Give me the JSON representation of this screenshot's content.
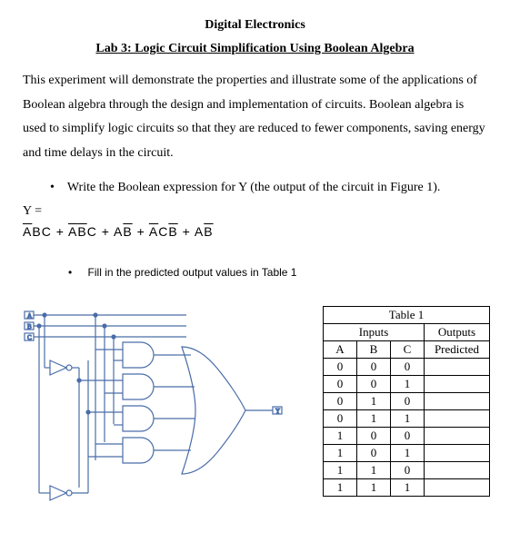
{
  "title": "Digital Electronics",
  "subtitle": "Lab 3: Logic Circuit Simplification Using Boolean Algebra",
  "paragraph": "This experiment will demonstrate the properties and illustrate some of the applications of Boolean algebra through the design and implementation of circuits. Boolean algebra is used to simplify logic circuits so that they are reduced to fewer components, saving energy and time delays in the circuit.",
  "bullet1": "Write the Boolean expression for Y (the output of the circuit in Figure 1).",
  "expr_label": "Y =",
  "handwritten_terms": {
    "t1a": "A",
    "t1b": "B",
    "t1c": "C",
    "plus1": " + ",
    "t2a": "A",
    "t2b": "B",
    "t2c": "C",
    "plus2": " + ",
    "t3a": "A",
    "t3b": "B",
    "plus3": " + ",
    "t4a": "A",
    "t4b": "C",
    "t4c": "B",
    "plus4": " + ",
    "t5a": "A",
    "t5b": "B"
  },
  "bullet2": "Fill in the predicted output values in Table 1",
  "table": {
    "title": "Table 1",
    "header_inputs": "Inputs",
    "header_outputs": "Outputs",
    "col_a": "A",
    "col_b": "B",
    "col_c": "C",
    "col_pred": "Predicted",
    "rows": [
      {
        "a": "0",
        "b": "0",
        "c": "0",
        "p": ""
      },
      {
        "a": "0",
        "b": "0",
        "c": "1",
        "p": ""
      },
      {
        "a": "0",
        "b": "1",
        "c": "0",
        "p": ""
      },
      {
        "a": "0",
        "b": "1",
        "c": "1",
        "p": ""
      },
      {
        "a": "1",
        "b": "0",
        "c": "0",
        "p": ""
      },
      {
        "a": "1",
        "b": "0",
        "c": "1",
        "p": ""
      },
      {
        "a": "1",
        "b": "1",
        "c": "0",
        "p": ""
      },
      {
        "a": "1",
        "b": "1",
        "c": "1",
        "p": ""
      }
    ]
  },
  "circuit": {
    "inputs": [
      "A",
      "B",
      "C"
    ],
    "output": "Y"
  }
}
